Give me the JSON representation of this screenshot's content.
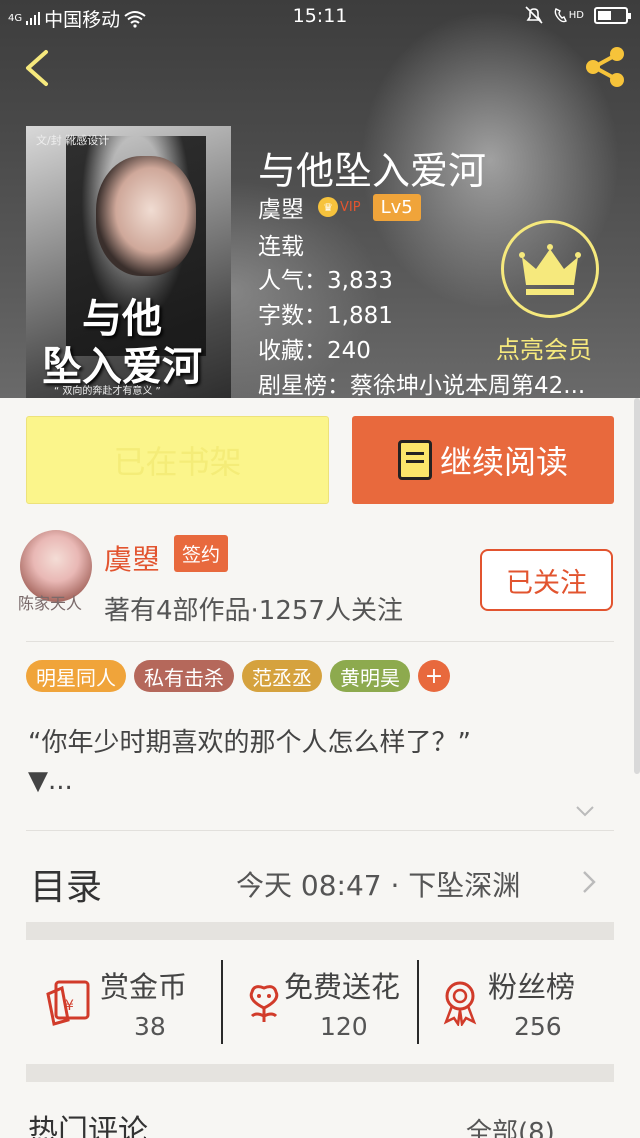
{
  "status_bar": {
    "signal": "4G",
    "carrier": "中国移动",
    "time": "15:11",
    "hd": "HD"
  },
  "book": {
    "title": "与他坠入爱河",
    "author": "虞曌",
    "vip_label": "VIP",
    "level": "Lv5",
    "status": "连载",
    "popularity": "人气：3,833",
    "word_count": "字数：1,881",
    "favorites": "收藏：240",
    "rank": "剧星榜：蔡徐坤小说本周第42..."
  },
  "cover": {
    "top_text": "文/封 靴感设计",
    "title_line1": "与他",
    "title_line2": "坠入爱河",
    "tagline": "“ 双向的奔赴才有意义 ”"
  },
  "member": {
    "label": "点亮会员"
  },
  "buttons": {
    "shelf": "已在书架",
    "read": "继续阅读",
    "follow": "已关注"
  },
  "author_card": {
    "avatar_caption": "陈家天人",
    "name": "虞曌",
    "signed_badge": "签约",
    "stats": "著有4部作品·1257人关注"
  },
  "tags": [
    {
      "label": "明星同人",
      "color": "#f0a43a"
    },
    {
      "label": "私有击杀",
      "color": "#b5685b"
    },
    {
      "label": "范丞丞",
      "color": "#d5a23e"
    },
    {
      "label": "黄明昊",
      "color": "#8daa4e"
    }
  ],
  "tag_more": "+",
  "intro": {
    "line1": "“你年少时期喜欢的那个人怎么样了？”",
    "line2": "▼..."
  },
  "toc": {
    "label": "目录",
    "latest": "今天 08:47 · 下坠深渊"
  },
  "actions": [
    {
      "title": "赏金币",
      "count": "38"
    },
    {
      "title": "免费送花",
      "count": "120"
    },
    {
      "title": "粉丝榜",
      "count": "256"
    }
  ],
  "comments": {
    "title": "热门评论",
    "all": "全部(8)"
  },
  "colors": {
    "accent": "#e8693d",
    "accent_text": "#e2542f",
    "member_gold": "#f6e97d",
    "shelf_yellow": "#fbf58b"
  }
}
